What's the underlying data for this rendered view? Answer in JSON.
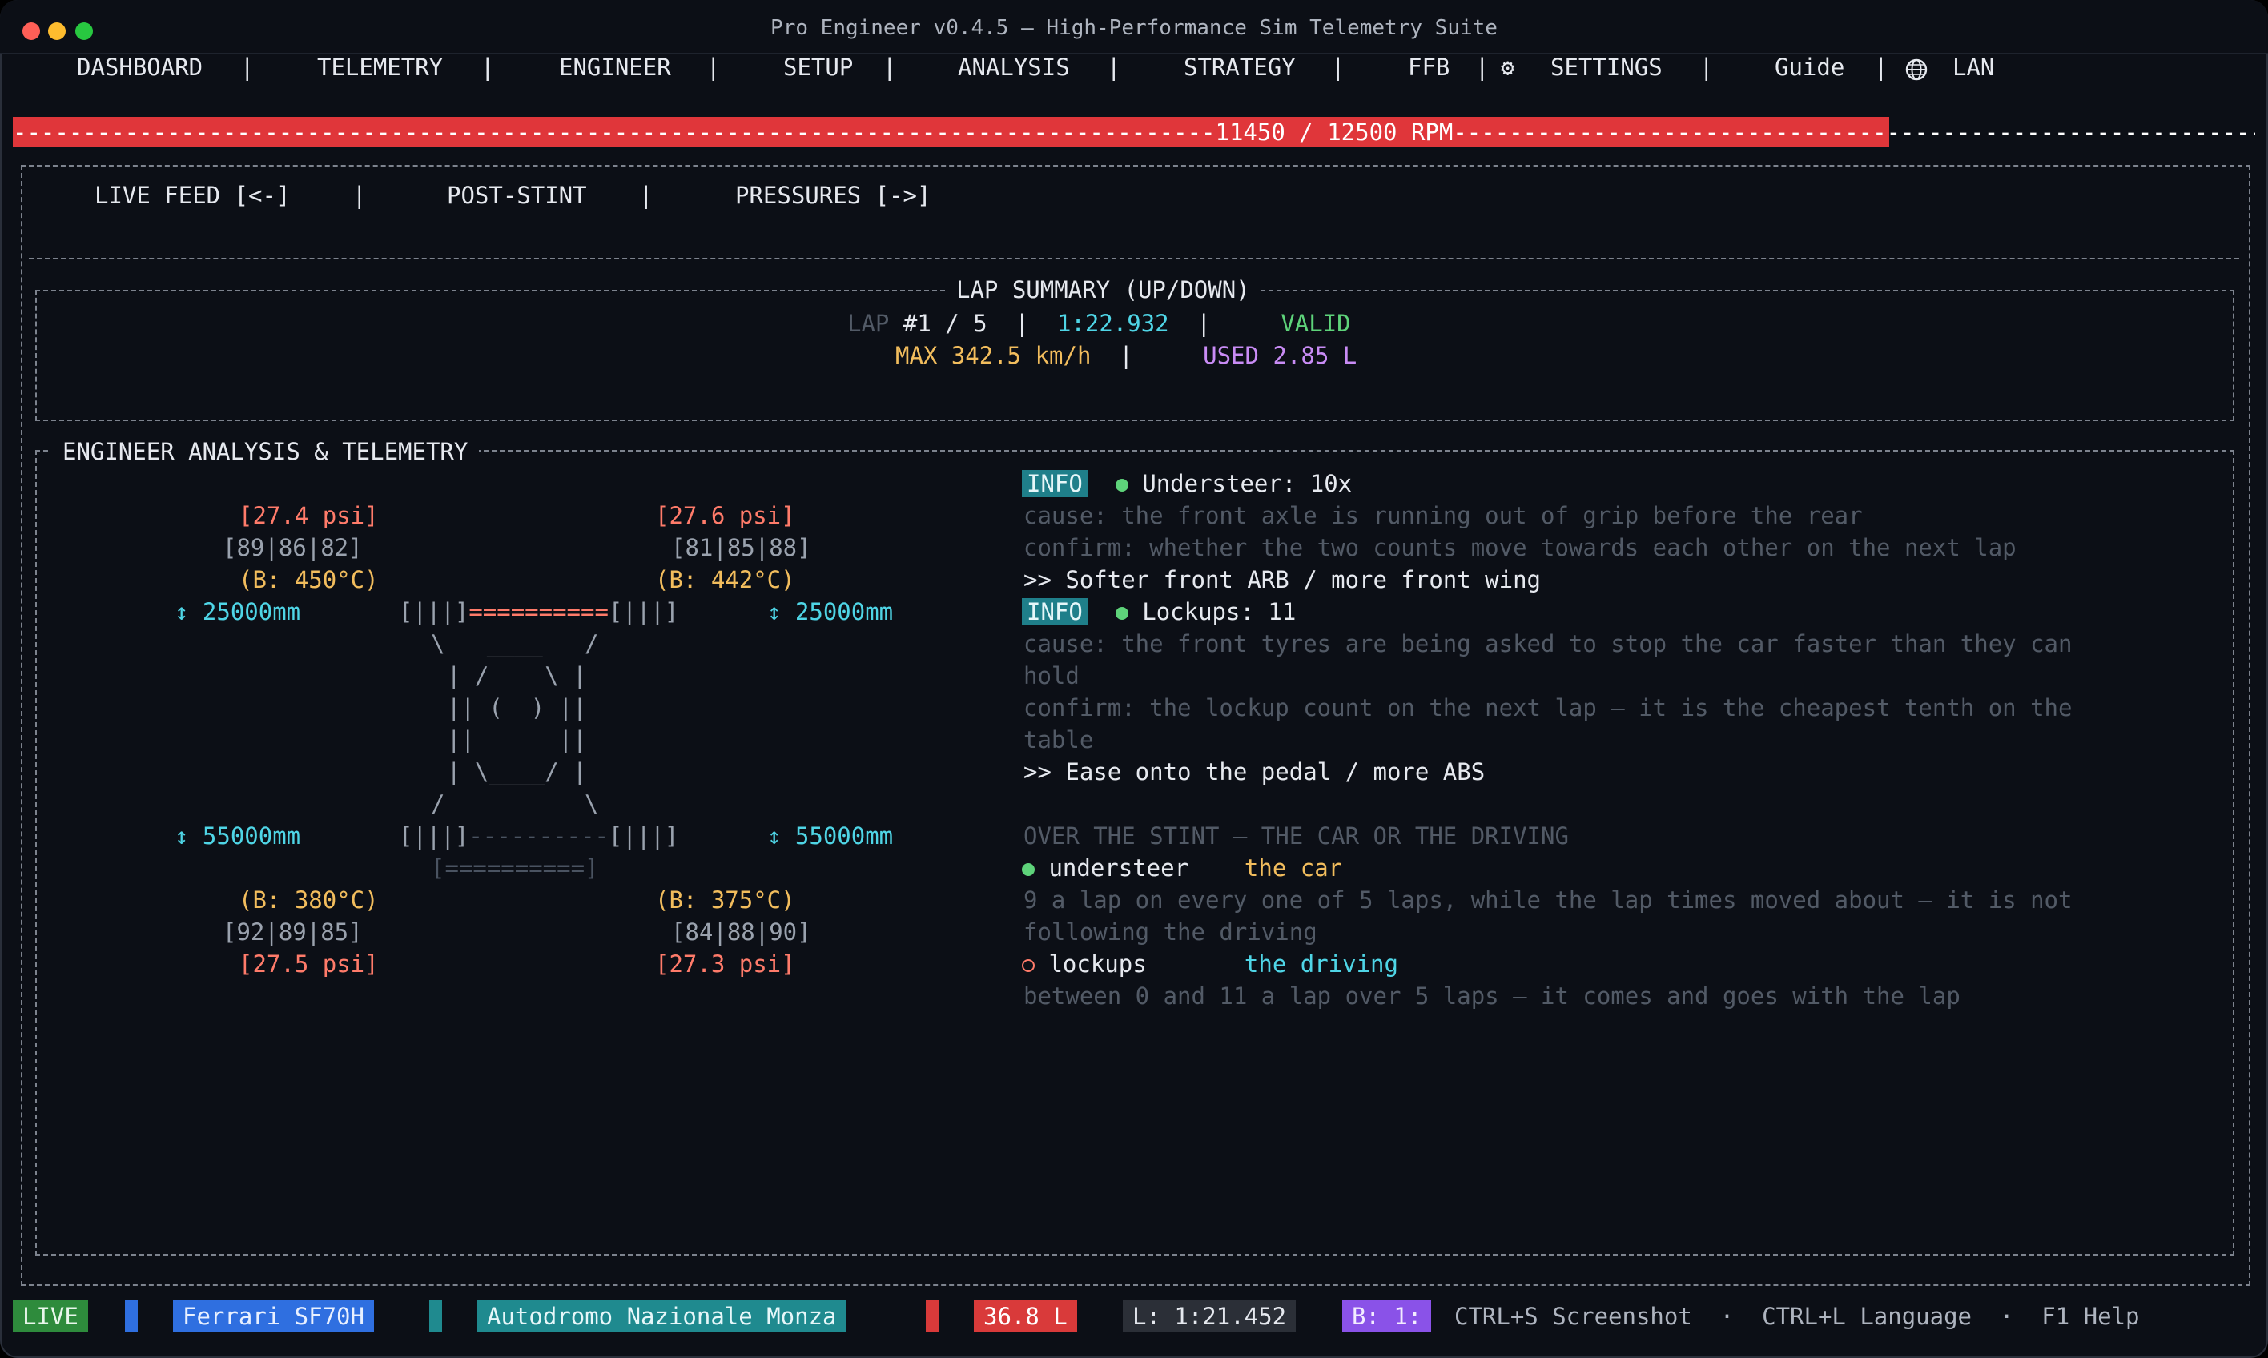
{
  "window": {
    "title": "Pro Engineer v0.4.5 – High-Performance Sim Telemetry Suite"
  },
  "nav": {
    "items": [
      "DASHBOARD",
      "TELEMETRY",
      "ENGINEER",
      "SETUP",
      "ANALYSIS",
      "STRATEGY",
      "FFB",
      "SETTINGS",
      "Guide",
      "LAN"
    ],
    "settings_icon": "gear-icon",
    "lan_icon": "globe-icon"
  },
  "rpm": {
    "label": "11450 / 12500 RPM",
    "current": 11450,
    "max": 12500,
    "color": "#e0363a"
  },
  "subtabs": {
    "live": "LIVE FEED [<-]",
    "post": "POST-STINT",
    "pressures": "PRESSURES [->]"
  },
  "lap_summary": {
    "title": "LAP SUMMARY (UP/DOWN)",
    "lap_label": "LAP",
    "lap_value": "#1 / 5",
    "time": "1:22.932",
    "status": "VALID",
    "max_speed": "MAX 342.5 km/h",
    "fuel_used": "USED 2.85 L"
  },
  "engineer": {
    "title": "ENGINEER ANALYSIS & TELEMETRY",
    "car": {
      "fl_psi": "[27.4 psi]",
      "fr_psi": "[27.6 psi]",
      "fl_temps": "[89|86|82]",
      "fr_temps": "[81|85|88]",
      "fl_brake": "(B: 450°C)",
      "fr_brake": "(B: 442°C)",
      "front_ride_left": "↕ 25000mm",
      "front_ride_right": "↕ 25000mm",
      "front_axle_l": "[|||]",
      "front_axle_mid": "==========",
      "front_axle_r": "[|||]",
      "body1": "\\   ____   /",
      "body2": "| /    \\ |",
      "body3": "|| (  ) ||",
      "body4": "||      ||",
      "body5": "| \\____/ |",
      "body6": "/          \\",
      "rear_ride_left": "↕ 55000mm",
      "rear_ride_right": "↕ 55000mm",
      "rear_axle_l": "[|||]",
      "rear_axle_mid": "----------",
      "rear_axle_r": "[|||]",
      "rear_wing": "[==========]",
      "rl_brake": "(B: 380°C)",
      "rr_brake": "(B: 375°C)",
      "rl_temps": "[92|89|85]",
      "rr_temps": "[84|88|90]",
      "rl_psi": "[27.5 psi]",
      "rr_psi": "[27.3 psi]"
    },
    "advice": [
      {
        "badge": "INFO",
        "title": "Understeer: 10x",
        "cause": "cause: the front axle is running out of grip before the rear",
        "confirm": "confirm: whether the two counts move towards each other on the next lap",
        "action": ">> Softer front ARB / more front wing"
      },
      {
        "badge": "INFO",
        "title": "Lockups: 11",
        "cause1": "cause: the front tyres are being asked to stop the car faster than they can",
        "cause2": "hold",
        "confirm1": "confirm: the lockup count on the next lap – it is the cheapest tenth on the",
        "confirm2": "table",
        "action": ">> Ease onto the pedal / more ABS"
      }
    ],
    "stint": {
      "heading": "OVER THE STINT – THE CAR OR THE DRIVING",
      "items": [
        {
          "name": "understeer",
          "verdict": "the car",
          "note1": "9 a lap on every one of 5 laps, while the lap times moved about – it is not",
          "note2": "following the driving"
        },
        {
          "name": "lockups",
          "verdict": "the driving",
          "note1": "between 0 and 11 a lap over 5 laps – it comes and goes with the lap"
        }
      ]
    }
  },
  "statusbar": {
    "live": "LIVE",
    "car": "Ferrari SF70H",
    "track": "Autodromo Nazionale Monza",
    "fuel": "36.8 L",
    "last": "L: 1:21.452",
    "best": "B: 1:",
    "hints": "CTRL+S Screenshot  ·  CTRL+L Language  ·  F1 Help"
  }
}
